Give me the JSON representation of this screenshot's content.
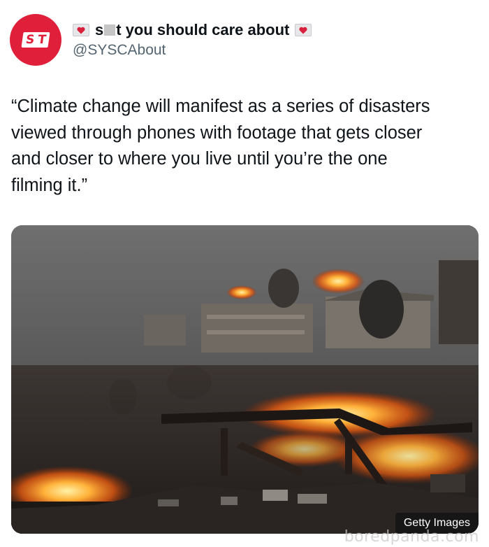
{
  "account": {
    "avatar_logo": "S  T",
    "name_start": "s",
    "name_end": "t you should care about",
    "handle": "@SYSCAbout"
  },
  "tweet": {
    "text": "“Climate change will manifest as a series of disasters\nviewed through phones with footage that gets closer\nand closer to where you live until you’re the one\nfilming it.”"
  },
  "media": {
    "description_icon": "wildfire-photo",
    "credit": "Getty Images"
  },
  "watermark": {
    "text": "boredpanda.com"
  },
  "colors": {
    "avatar_bg": "#e0203a",
    "handle": "#536471",
    "heart": "#d81f3c"
  }
}
